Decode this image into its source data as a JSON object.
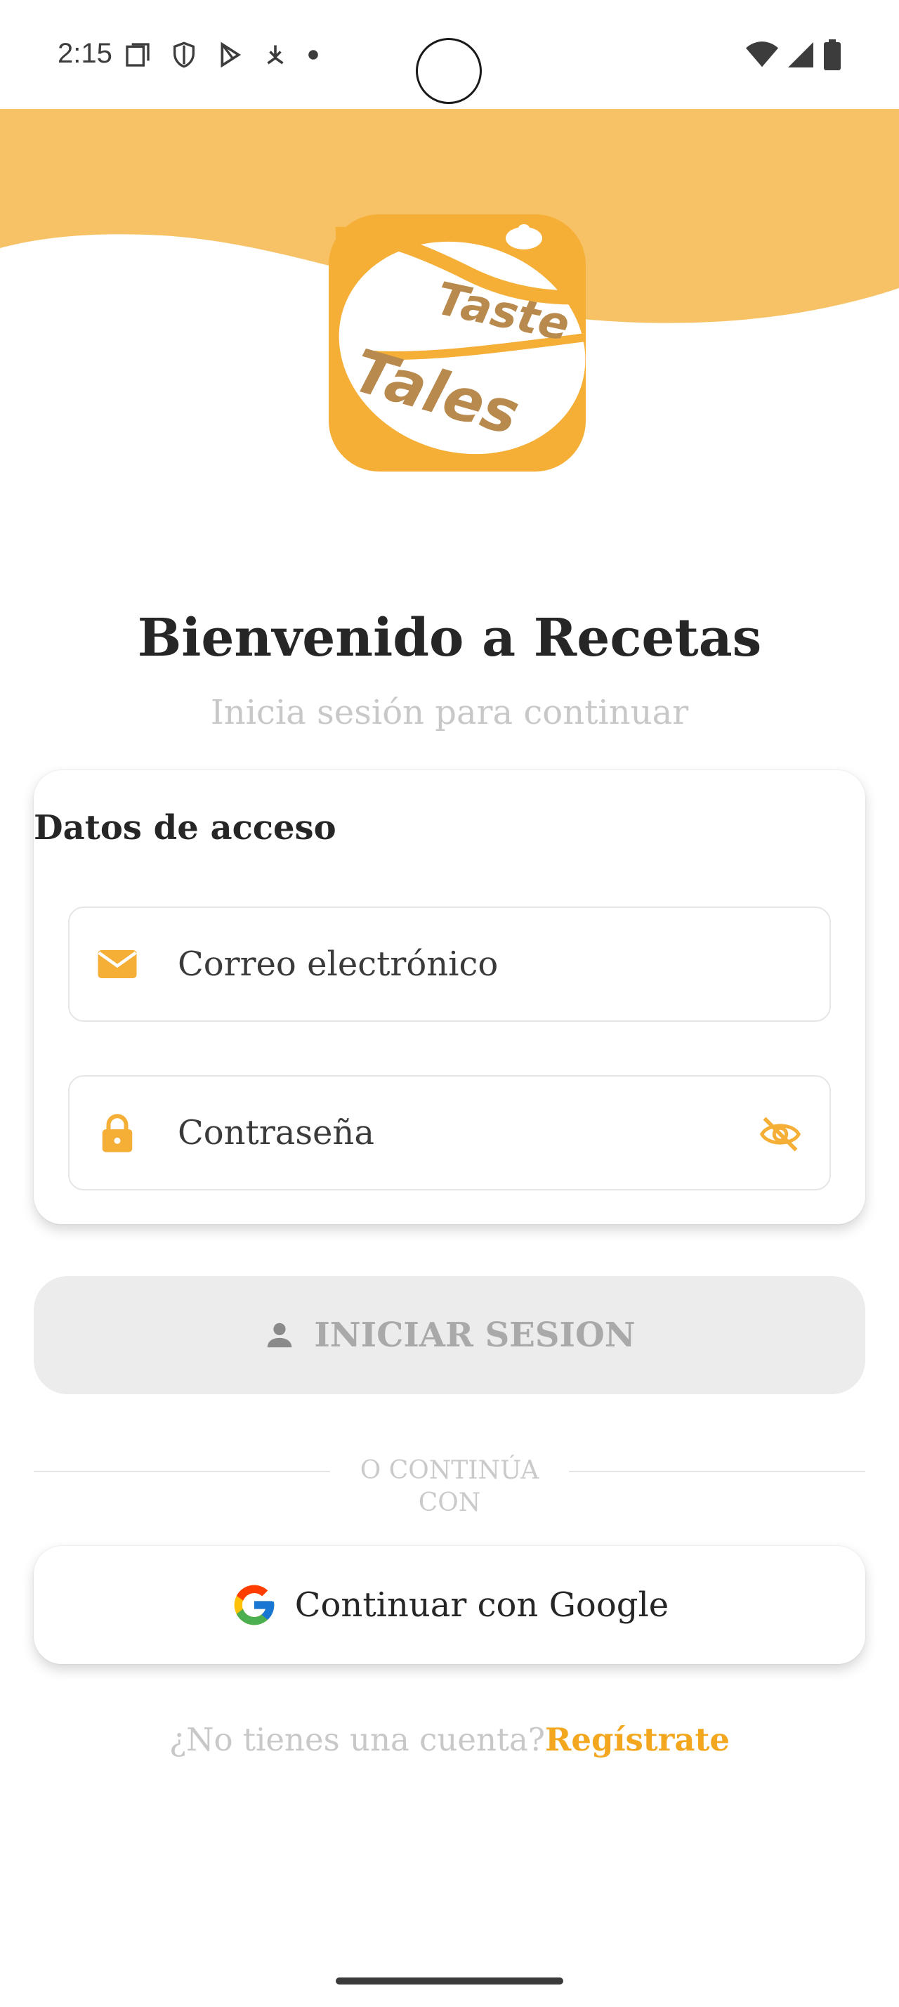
{
  "status_bar": {
    "time": "2:15"
  },
  "header": {
    "logo_text_top": "Taste",
    "logo_text_bottom": "Tales"
  },
  "welcome": {
    "title": "Bienvenido a Recetas",
    "subtitle": "Inicia sesión para continuar"
  },
  "login_card": {
    "title": "Datos de acceso",
    "email_placeholder": "Correo electrónico",
    "password_placeholder": "Contraseña"
  },
  "login_button": {
    "label": "INICIAR SESION"
  },
  "divider": {
    "label": "O CONTINÚA CON"
  },
  "google_button": {
    "label": "Continuar con Google"
  },
  "register": {
    "prompt": "¿No tienes una cuenta?",
    "link": "Regístrate"
  },
  "colors": {
    "accent": "#f5ae36",
    "header_wave": "#f7c266",
    "logo_brown": "#b88a4d",
    "button_disabled": "#ececec"
  }
}
